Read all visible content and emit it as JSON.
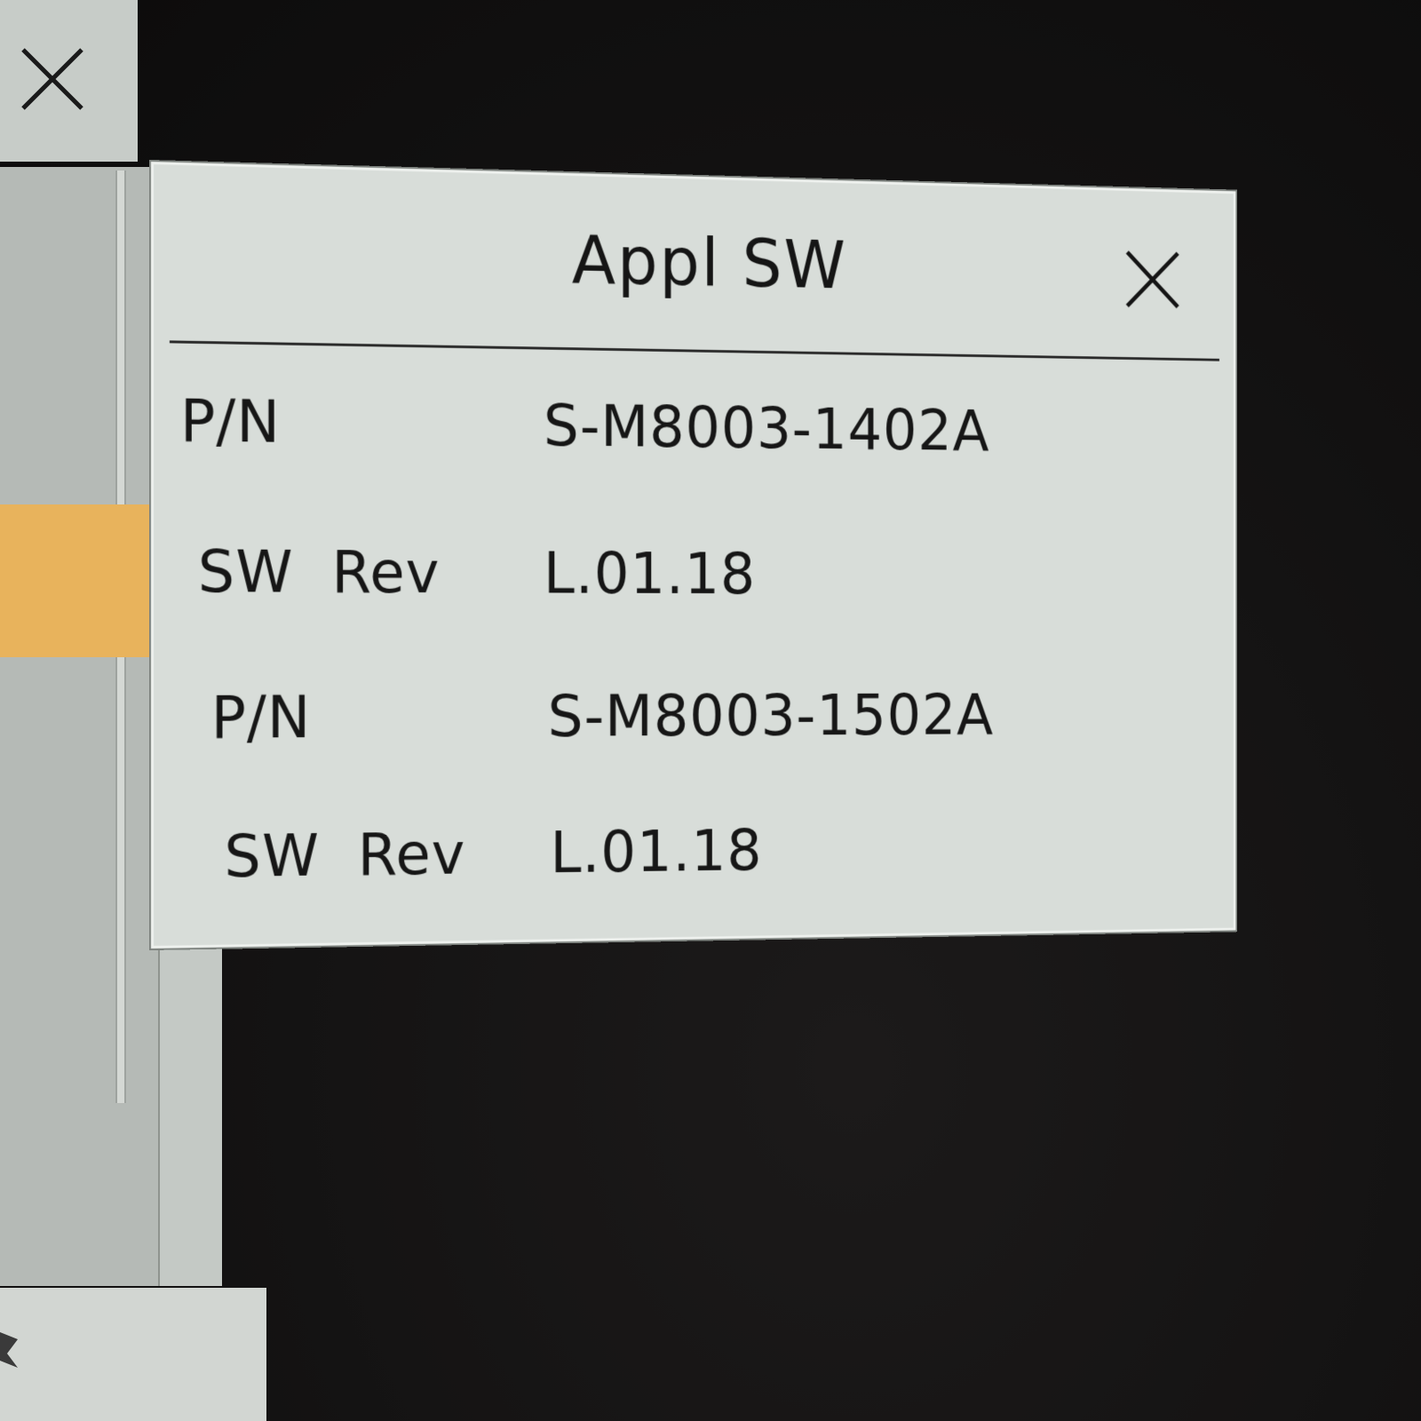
{
  "dialog": {
    "title": "Appl SW",
    "close_icon": "close-icon",
    "rows": [
      {
        "label": "P/N",
        "value": "S-M8003-1402A"
      },
      {
        "label": "SW  Rev",
        "value": "L.01.18"
      },
      {
        "label": "P/N",
        "value": "S-M8003-1502A"
      },
      {
        "label": "SW  Rev",
        "value": "L.01.18"
      }
    ]
  },
  "background_window": {
    "close_icon": "close-icon",
    "highlight_color": "#e8b35c"
  },
  "colors": {
    "dialog_bg": "#d8ddd9",
    "screen_bg": "#141313",
    "text": "#161616"
  }
}
